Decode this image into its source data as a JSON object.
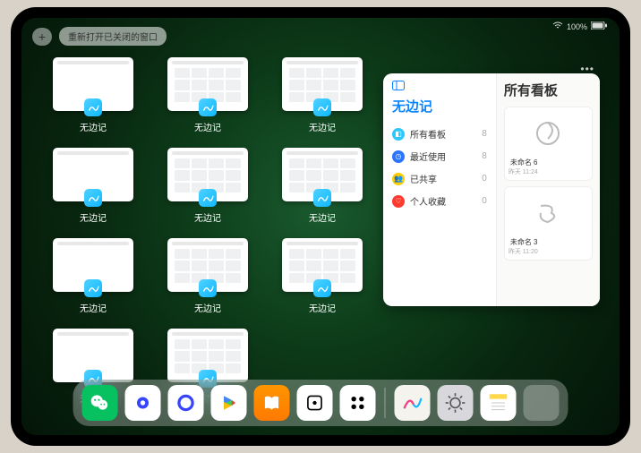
{
  "status": {
    "battery": "100%"
  },
  "topbar": {
    "reopen_label": "重新打开已关闭的窗口"
  },
  "thumbs": {
    "app_label": "无边记"
  },
  "panel": {
    "left_title": "无边记",
    "right_title": "所有看板",
    "categories": [
      {
        "label": "所有看板",
        "count": "8",
        "color": "#2dc7ff"
      },
      {
        "label": "最近使用",
        "count": "8",
        "color": "#2a74ff"
      },
      {
        "label": "已共享",
        "count": "0",
        "color": "#ffcc00"
      },
      {
        "label": "个人收藏",
        "count": "0",
        "color": "#ff3b30"
      }
    ],
    "boards": [
      {
        "name": "未命名 6",
        "date": "昨天 11:24"
      },
      {
        "name": "未命名 3",
        "date": "昨天 11:20"
      }
    ]
  },
  "dock": {
    "apps": [
      {
        "name": "wechat"
      },
      {
        "name": "quark-hd"
      },
      {
        "name": "quark"
      },
      {
        "name": "play"
      },
      {
        "name": "books"
      },
      {
        "name": "dice"
      },
      {
        "name": "dots"
      },
      {
        "name": "freeform"
      },
      {
        "name": "settings"
      },
      {
        "name": "notes"
      },
      {
        "name": "app-library"
      }
    ]
  }
}
